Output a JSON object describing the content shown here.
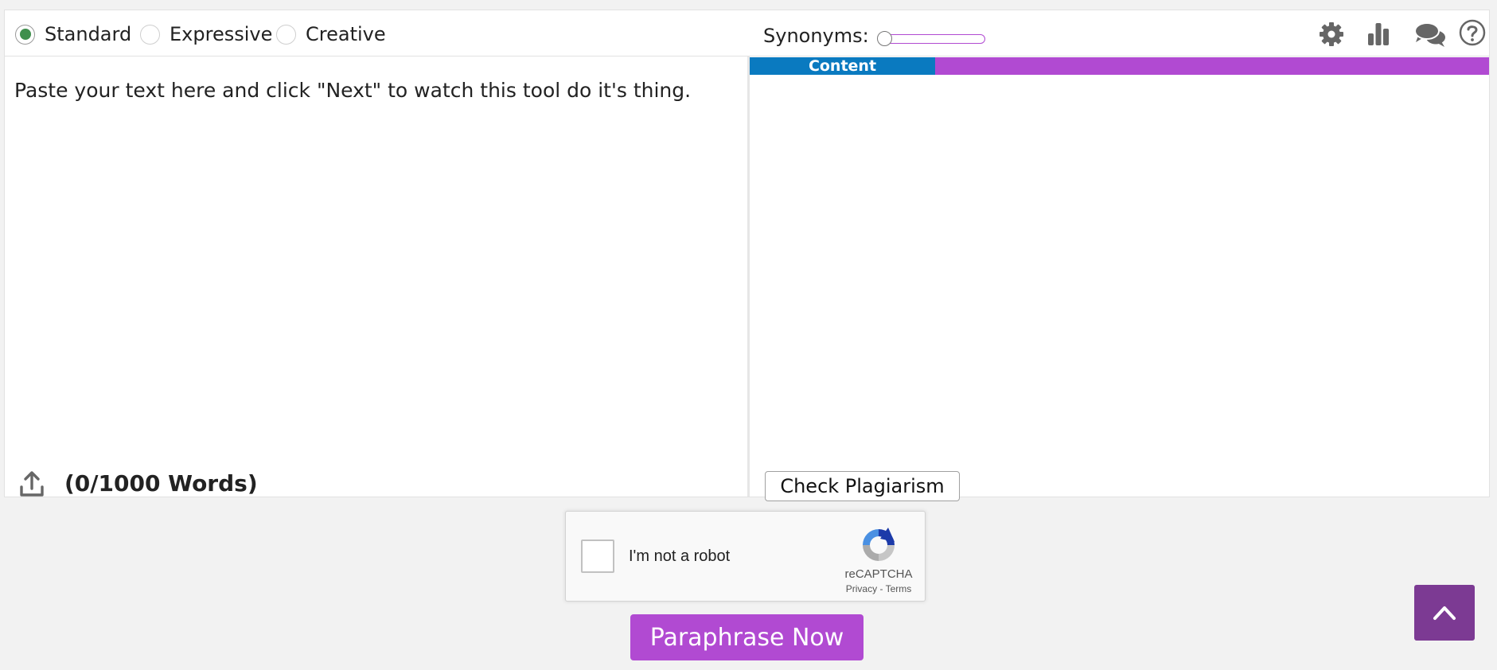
{
  "modes": [
    {
      "label": "Standard",
      "checked": true
    },
    {
      "label": "Expressive",
      "checked": false
    },
    {
      "label": "Creative",
      "checked": false
    }
  ],
  "synonyms": {
    "label": "Synonyms:",
    "level": 0
  },
  "toolbar_icons": [
    "gear-icon",
    "bar-chart-icon",
    "chat-bubbles-icon",
    "help-circle-icon"
  ],
  "input": {
    "placeholder": "Paste your text here and click \"Next\" to watch this tool do it's thing.",
    "word_count": "(0/1000 Words)"
  },
  "output": {
    "tab_label": "Content",
    "check_plagiarism_label": "Check Plagiarism"
  },
  "recaptcha": {
    "label": "I'm not a robot",
    "brand": "reCAPTCHA",
    "privacy": "Privacy",
    "separator": " - ",
    "terms": "Terms"
  },
  "paraphrase_label": "Paraphrase Now",
  "colors": {
    "accent": "#b14ad2",
    "tab_blue": "#0a7ac0",
    "radio_checked": "#3f8f4d",
    "scroll_top": "#7c3a93"
  }
}
